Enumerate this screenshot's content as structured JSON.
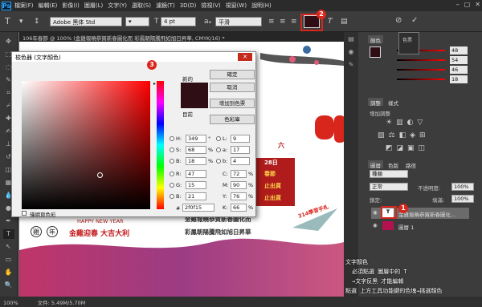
{
  "app": {
    "logo": "Ps"
  },
  "menu": [
    "檔案(F)",
    "編輯(E)",
    "影像(I)",
    "圖層(L)",
    "文字(Y)",
    "選取(S)",
    "濾鏡(T)",
    "3D(D)",
    "檢視(V)",
    "視窗(W)",
    "說明(H)"
  ],
  "window_controls": [
    "–",
    "▢",
    "✕"
  ],
  "options": {
    "font": "Adobe 黑体 Std",
    "size": "4 pt",
    "aa": "平滑",
    "tool_glyph": "T"
  },
  "doc_tab": "106年春節 @ 100% (金雞報曉恭賀新春圖化而 彩鳳朝陽騰飛如旭日昇華, CMYK/16) *",
  "colors": {
    "accent_red": "#d9261c",
    "current": "#2f0f15"
  },
  "dialog": {
    "title": "檢色器 (文字顏色)",
    "new_label": "新的",
    "current_label": "目前",
    "buttons": [
      "確定",
      "取消",
      "增加到色票",
      "色彩庫"
    ],
    "only_web": "僅網頁色彩",
    "hsb": [
      {
        "k": "H:",
        "v": "349",
        "u": "°"
      },
      {
        "k": "S:",
        "v": "68",
        "u": "%"
      },
      {
        "k": "B:",
        "v": "18",
        "u": "%"
      }
    ],
    "rgb": [
      {
        "k": "R:",
        "v": "47"
      },
      {
        "k": "G:",
        "v": "15"
      },
      {
        "k": "B:",
        "v": "21"
      }
    ],
    "lab": [
      {
        "k": "L:",
        "v": "9"
      },
      {
        "k": "a:",
        "v": "17"
      },
      {
        "k": "b:",
        "v": "4"
      }
    ],
    "cmyk": [
      {
        "k": "C:",
        "v": "72",
        "u": "%"
      },
      {
        "k": "M:",
        "v": "90",
        "u": "%"
      },
      {
        "k": "Y:",
        "v": "76",
        "u": "%"
      },
      {
        "k": "K:",
        "v": "66",
        "u": "%"
      }
    ],
    "hex_label": "#",
    "hex": "2f0f15"
  },
  "badges": [
    "1",
    "2",
    "3"
  ],
  "canvas_text": {
    "happy": "HAPPY NEW YEAR",
    "greeting": "金雞迎春 大吉大利",
    "chars": [
      "雞",
      "年"
    ],
    "poem1": "金雞報曉恭賀新春圖化而",
    "poem2": "彩鳳朝陽騰飛如旭日昇華",
    "stamp": "314學習手札",
    "date": "28日",
    "festival": "春節",
    "ship1": "止出貨",
    "ship2": "止出貨",
    "six": "六"
  },
  "notes": [
    "文字顏色",
    "必須點選 圖層中的 T",
    "→文字反黑 才能編輯",
    "點選 上方工具功能鍵的色塊→挑選顏色"
  ],
  "panels": {
    "color_tab": "顏色",
    "swatches_tab": "色票",
    "c_vals": [
      "48",
      "54",
      "46",
      "18"
    ],
    "adjust_tabs": [
      "調整",
      "樣式"
    ],
    "adjust_title": "增加調整",
    "layer_tabs": [
      "圖層",
      "色版",
      "路徑"
    ],
    "kind": "種類",
    "normal": "正常",
    "opacity_label": "不透明度:",
    "opacity": "100%",
    "lock_label": "鎖定:",
    "fill_label": "填滿:",
    "fill": "100%",
    "layers": [
      {
        "name": "金雞報曉恭賀新春圖化...",
        "thumb": "T"
      },
      {
        "name": "圖層 1",
        "thumb": ""
      }
    ]
  },
  "status": {
    "zoom": "100%",
    "doc": "文件: 5.49M/5.70M"
  }
}
